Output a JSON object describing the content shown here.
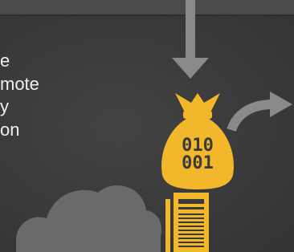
{
  "caption_lines": [
    "e",
    "mote",
    "y",
    "on"
  ],
  "bag": {
    "line1": "010",
    "line2": "001"
  },
  "colors": {
    "background": "#3b3b3b",
    "gold": "#f3b72b",
    "arrow": "#8a8a8a",
    "cloud": "#6a6a6a",
    "text": "#f0f0f0"
  },
  "icons": [
    "down-arrow-icon",
    "curved-arrow-icon",
    "money-bag-icon",
    "server-tower-icon",
    "cloud-icon"
  ]
}
